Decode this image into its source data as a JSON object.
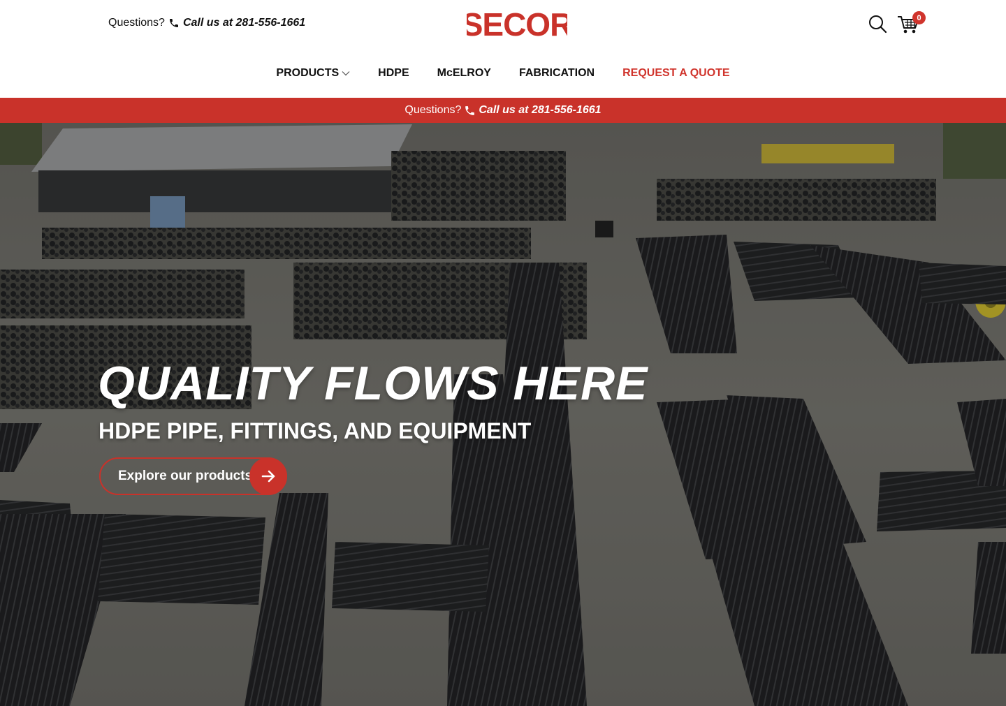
{
  "header": {
    "phone_prefix": "Questions?",
    "phone_text": "Call us at 281-556-1661",
    "logo_text": "SECOR",
    "cart_count": "0"
  },
  "nav": {
    "items": [
      {
        "label": "PRODUCTS"
      },
      {
        "label": "HDPE"
      },
      {
        "label": "McELROY"
      },
      {
        "label": "FABRICATION"
      },
      {
        "label": "REQUEST A QUOTE"
      }
    ]
  },
  "banner": {
    "prefix": "Questions?",
    "phone_text": "Call us at 281-556-1661"
  },
  "hero": {
    "title": "QUALITY FLOWS HERE",
    "subtitle": "HDPE PIPE, FITTINGS, AND EQUIPMENT",
    "cta_label": "Explore our products"
  },
  "colors": {
    "brand_red": "#c9322a",
    "text_dark": "#111111",
    "white": "#ffffff"
  },
  "icons": {
    "phone": "phone-icon",
    "search": "search-icon",
    "cart": "cart-icon",
    "chevron": "chevron-down-icon",
    "arrow": "arrow-right-icon"
  }
}
